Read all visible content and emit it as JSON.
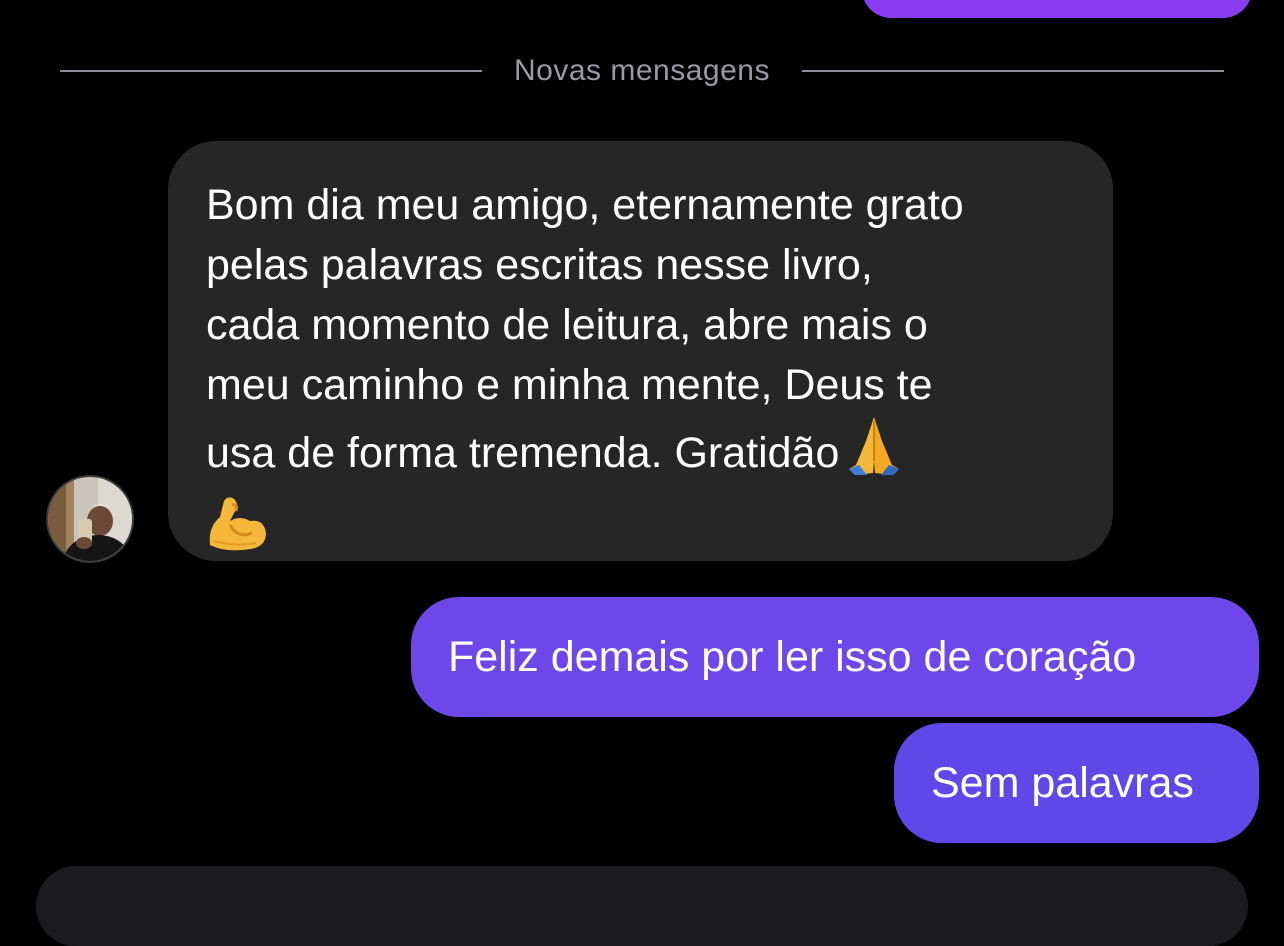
{
  "divider": {
    "label": "Novas mensagens"
  },
  "received_message": {
    "lines": [
      "Bom dia meu amigo, eternamente grato",
      "pelas palavras escritas nesse livro,",
      "cada momento de leitura, abre mais o",
      "meu caminho e minha mente, Deus te",
      "usa de forma tremenda. Gratidão"
    ],
    "text": "Bom dia meu amigo, eternamente grato\npelas palavras escritas nesse livro,\ncada momento de leitura, abre mais o\nmeu caminho e minha mente, Deus te\nusa de forma tremenda. Gratidão",
    "emojis": [
      "praying-hands-emoji",
      "flexed-biceps-emoji"
    ]
  },
  "sent_messages": [
    {
      "text": "Feliz demais por ler isso de coração"
    },
    {
      "text": "Sem palavras"
    }
  ],
  "colors": {
    "background": "#000000",
    "received_bubble": "#262626",
    "sent_bubble_1": "#6d47ea",
    "sent_bubble_2": "#6048e8",
    "top_bubble": "#8a3cf0",
    "divider": "#8e8e93"
  }
}
